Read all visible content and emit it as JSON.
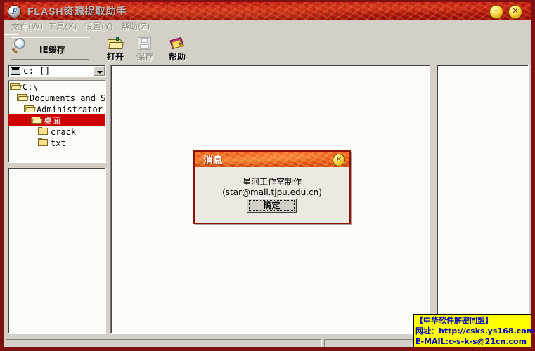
{
  "window": {
    "title": "FLASH资源提取助手",
    "app_icon": "flash-logo-icon",
    "minimize_label": "−",
    "close_label": "✕"
  },
  "menu": {
    "items": [
      {
        "label": "文件(W)"
      },
      {
        "label": "工具(X)"
      },
      {
        "label": "设置(Y)"
      },
      {
        "label": "帮助(Z)"
      }
    ]
  },
  "toolbar": {
    "iecache_label": "IE缓存",
    "open_label": "打开",
    "save_label": "保存",
    "help_label": "帮助"
  },
  "drive": {
    "value": "c:  []",
    "icon": "drive-icon",
    "arrow": "chevron-down-icon"
  },
  "tree": {
    "items": [
      {
        "label": "C:\\",
        "indent": 2,
        "icon": "folder-open-icon",
        "selected": false
      },
      {
        "label": "Documents and Settin",
        "indent": 12,
        "icon": "folder-open-icon",
        "selected": false
      },
      {
        "label": "Administrator",
        "indent": 22,
        "icon": "folder-open-icon",
        "selected": false
      },
      {
        "label": "桌面",
        "indent": 32,
        "icon": "folder-open-icon",
        "selected": true
      },
      {
        "label": "crack",
        "indent": 42,
        "icon": "folder-closed-icon",
        "selected": false
      },
      {
        "label": "txt",
        "indent": 42,
        "icon": "folder-closed-icon",
        "selected": false
      }
    ]
  },
  "dialog": {
    "title": "消息",
    "message": "星河工作室制作(star@mail.tjpu.edu.cn)",
    "ok_label": "确定",
    "close_label": "✕"
  },
  "watermark": {
    "line1": "【中华软件解密同盟】",
    "line2": "网址：http://csks.ys168.com",
    "line3": "E-MAIL:c-s-k-s@21cn.com"
  },
  "colors": {
    "title_bar_red": "#b0140c",
    "frame_border": "#7d1010",
    "dialog_orange": "#e4560e",
    "selection_red": "#cc0000",
    "face": "#d4d0c8",
    "watermark_bg": "#ffff00",
    "watermark_text": "#0000c8"
  }
}
